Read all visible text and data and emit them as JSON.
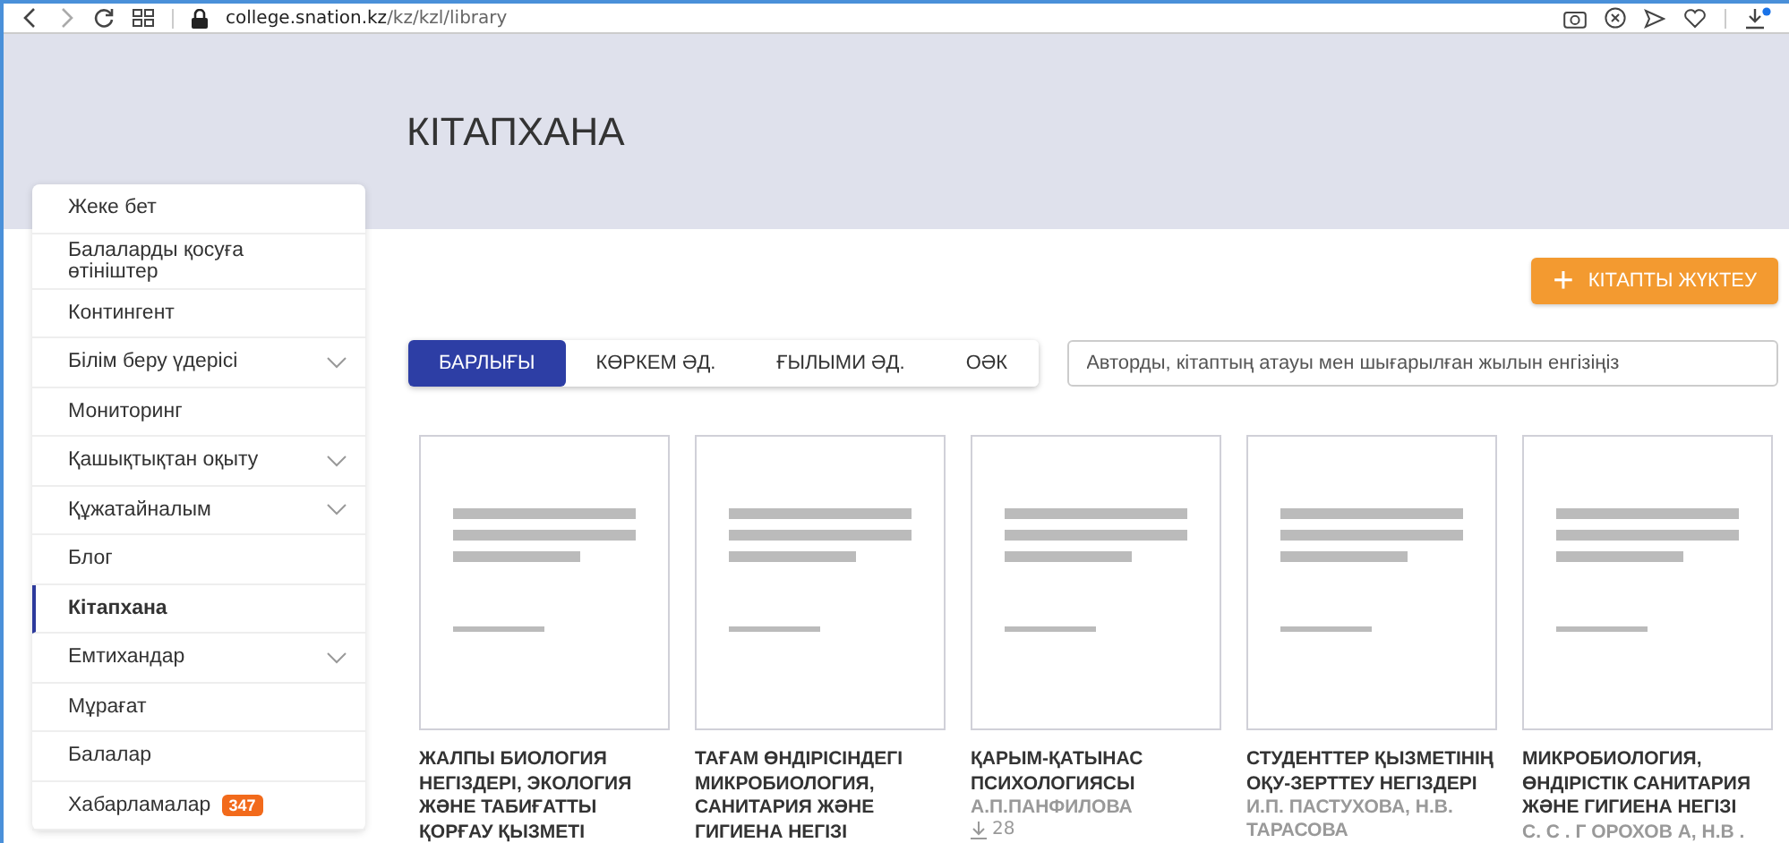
{
  "browser": {
    "url_host": "college.snation.kz",
    "url_path": "/kz/kzl/library"
  },
  "page_title": "КІТАПХАНА",
  "sidebar": {
    "items": [
      {
        "label": "Жеке бет",
        "selected": false,
        "expandable": false
      },
      {
        "label": "Балаларды қосуға өтініштер",
        "selected": false,
        "expandable": false
      },
      {
        "label": "Контингент",
        "selected": false,
        "expandable": false
      },
      {
        "label": "Білім беру үдерісі",
        "selected": false,
        "expandable": true
      },
      {
        "label": "Мониторинг",
        "selected": false,
        "expandable": false
      },
      {
        "label": "Қашықтықтан оқыту",
        "selected": false,
        "expandable": true
      },
      {
        "label": "Құжатайналым",
        "selected": false,
        "expandable": true
      },
      {
        "label": "Блог",
        "selected": false,
        "expandable": false
      },
      {
        "label": "Кітапхана",
        "selected": true,
        "expandable": false
      },
      {
        "label": "Емтихандар",
        "selected": false,
        "expandable": true
      },
      {
        "label": "Мұрағат",
        "selected": false,
        "expandable": false
      },
      {
        "label": "Балалар",
        "selected": false,
        "expandable": false
      },
      {
        "label": "Хабарламалар",
        "selected": false,
        "expandable": false,
        "badge": "347"
      }
    ]
  },
  "upload_button": {
    "icon": "+",
    "label": "КІТАПТЫ ЖҮКТЕУ"
  },
  "tabs": [
    {
      "label": "БАРЛЫҒЫ",
      "selected": true
    },
    {
      "label": "КӨРКЕМ ӘД.",
      "selected": false
    },
    {
      "label": "ҒЫЛЫМИ ӘД.",
      "selected": false
    },
    {
      "label": "ОӘК",
      "selected": false
    }
  ],
  "search": {
    "placeholder": "Авторды, кітаптың атауы мен шығарылған жылын енгізіңіз"
  },
  "books": [
    {
      "title": "ЖАЛПЫ БИОЛОГИЯ НЕГІЗДЕРІ, ЭКОЛОГИЯ ЖӘНЕ ТАБИҒАТТЫ ҚОРҒАУ ҚЫЗМЕТІ"
    },
    {
      "title": "ТАҒАМ ӨНДІРІСІНДЕГІ МИКРОБИОЛОГИЯ, САНИТАРИЯ ЖӘНЕ ГИГИЕНА НЕГІЗІ"
    },
    {
      "title": "ҚАРЫМ-ҚАТЫНАС ПСИХОЛОГИЯСЫ",
      "author": "А.П.ПАНФИЛОВА",
      "downloads": "28"
    },
    {
      "title": "СТУДЕНТТЕР ҚЫЗМЕТІНІҢ ОҚУ-ЗЕРТТЕУ НЕГІЗДЕРІ",
      "author": "И.П. ПАСТУХОВА, Н.В. ТАРАСОВА"
    },
    {
      "title": "МИКРОБИОЛОГИЯ, ӨНДІРІСТІК САНИТАРИЯ ЖӘНЕ ГИГИЕНА НЕГІЗІ",
      "author": "С. С . Г OРОХОВ А, Н.В ."
    }
  ]
}
